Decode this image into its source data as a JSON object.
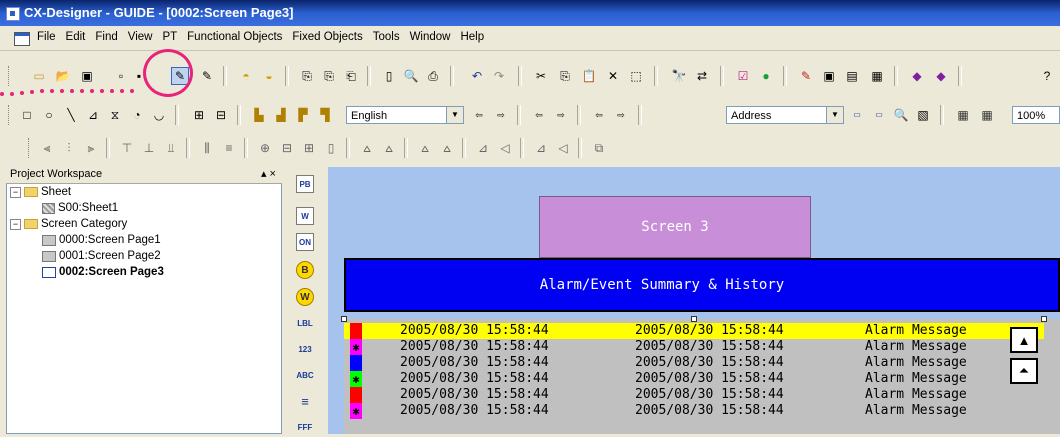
{
  "window": {
    "title": "CX-Designer - GUIDE - [0002:Screen Page3]"
  },
  "menu": [
    "File",
    "Edit",
    "Find",
    "View",
    "PT",
    "Functional Objects",
    "Fixed Objects",
    "Tools",
    "Window",
    "Help"
  ],
  "toolbar": {
    "language_combo": "English",
    "address_combo": "Address",
    "zoom_combo": "100%"
  },
  "workspace": {
    "title": "Project Workspace",
    "close": "▴ ×",
    "tree": [
      {
        "label": "Sheet"
      },
      {
        "label": "S00:Sheet1"
      },
      {
        "label": "Screen Category"
      },
      {
        "label": "0000:Screen Page1"
      },
      {
        "label": "0001:Screen Page2"
      },
      {
        "label": "0002:Screen Page3"
      }
    ]
  },
  "palette": [
    "PB",
    "W",
    "ON",
    "B",
    "W",
    "LBL",
    "123",
    "ABC",
    "≡",
    "FFF"
  ],
  "canvas": {
    "screen_button": "Screen 3",
    "alarm_header": "Alarm/Event Summary & History",
    "alarm_rows": [
      {
        "d1": "2005/08/30  15:58:44",
        "d2": "2005/08/30  15:58:44",
        "msg": "Alarm Message",
        "color": "#ff0000",
        "mark": ""
      },
      {
        "d1": "2005/08/30  15:58:44",
        "d2": "2005/08/30  15:58:44",
        "msg": "Alarm Message",
        "color": "#ff00ff",
        "mark": "✱"
      },
      {
        "d1": "2005/08/30  15:58:44",
        "d2": "2005/08/30  15:58:44",
        "msg": "Alarm Message",
        "color": "#0000ff",
        "mark": ""
      },
      {
        "d1": "2005/08/30  15:58:44",
        "d2": "2005/08/30  15:58:44",
        "msg": "Alarm Message",
        "color": "#00ff00",
        "mark": "✱"
      },
      {
        "d1": "2005/08/30  15:58:44",
        "d2": "2005/08/30  15:58:44",
        "msg": "Alarm Message",
        "color": "#ff0000",
        "mark": ""
      },
      {
        "d1": "2005/08/30  15:58:44",
        "d2": "2005/08/30  15:58:44",
        "msg": "Alarm Message",
        "color": "#ff00ff",
        "mark": "✱"
      }
    ],
    "scroll_up": "▲",
    "scroll_top": "⏶"
  }
}
